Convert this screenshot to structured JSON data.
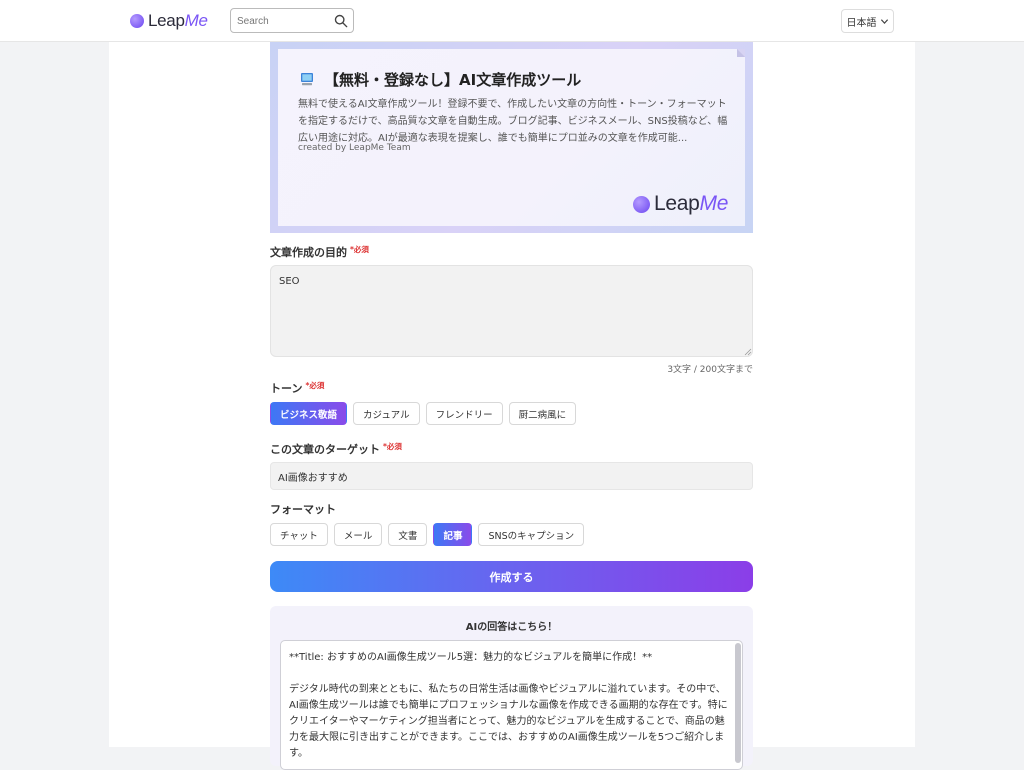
{
  "header": {
    "logo_prefix": "Leap",
    "logo_suffix": "Me",
    "search_placeholder": "Search",
    "language": "日本語"
  },
  "banner": {
    "title": "【無料・登録なし】AI文章作成ツール",
    "description": "無料で使えるAI文章作成ツール！登録不要で、作成したい文章の方向性・トーン・フォーマットを指定するだけで、高品質な文章を自動生成。ブログ記事、ビジネスメール、SNS投稿など、幅広い用途に対応。AIが最適な表現を提案し、誰でも簡単にプロ並みの文章を作成可能...",
    "created_by": "created by LeapMe Team",
    "logo_prefix": "Leap",
    "logo_suffix": "Me"
  },
  "form": {
    "purpose": {
      "label": "文章作成の目的",
      "required": "*必須",
      "value": "SEO",
      "counter": "3文字 / 200文字まで"
    },
    "tone": {
      "label": "トーン",
      "required": "*必須",
      "options": [
        "ビジネス敬語",
        "カジュアル",
        "フレンドリー",
        "厨二病風に"
      ],
      "selected": "ビジネス敬語"
    },
    "target": {
      "label": "この文章のターゲット",
      "required": "*必須",
      "value": "AI画像おすすめ"
    },
    "format": {
      "label": "フォーマット",
      "options": [
        "チャット",
        "メール",
        "文書",
        "記事",
        "SNSのキャプション"
      ],
      "selected": "記事"
    },
    "submit_label": "作成する"
  },
  "answer": {
    "title": "AIの回答はこちら！",
    "paragraphs": [
      "**Title: おすすめのAI画像生成ツール5選：魅力的なビジュアルを簡単に作成！**",
      "デジタル時代の到来とともに、私たちの日常生活は画像やビジュアルに溢れています。その中で、AI画像生成ツールは誰でも簡単にプロフェッショナルな画像を作成できる画期的な存在です。特にクリエイターやマーケティング担当者にとって、魅力的なビジュアルを生成することで、商品の魅力を最大限に引き出すことができます。ここでは、おすすめのAI画像生成ツールを5つご紹介します。"
    ]
  },
  "colors": {
    "accent_start": "#3d78f5",
    "accent_end": "#8a4bea",
    "required": "#d33333"
  }
}
